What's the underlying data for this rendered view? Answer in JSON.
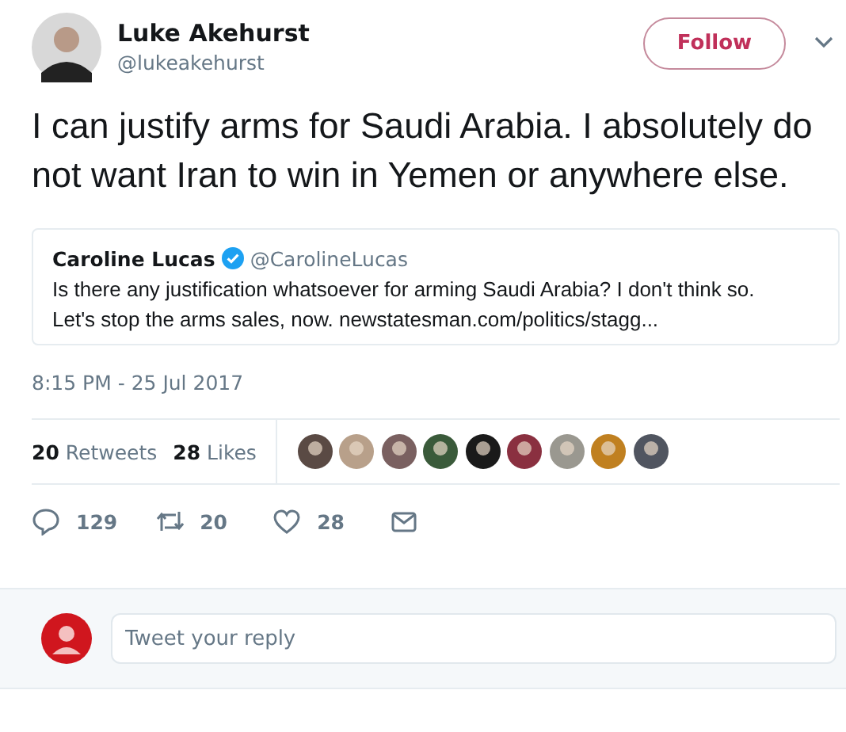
{
  "tweet": {
    "author": {
      "name": "Luke Akehurst",
      "handle": "@lukeakehurst"
    },
    "follow_button": "Follow",
    "text": "I can justify arms for Saudi Arabia. I absolutely do not want Iran to win in Yemen or anywhere else.",
    "quoted_tweet": {
      "name": "Caroline Lucas",
      "verified": true,
      "handle": "@CarolineLucas",
      "lines": [
        "Is there any justification whatsoever for arming Saudi Arabia? I don't think so.",
        "Let's stop the arms sales, now. newstatesman.com/politics/stagg..."
      ]
    },
    "timestamp": "8:15 PM - 25 Jul 2017",
    "stats": [
      {
        "count": "20",
        "label": "Retweets"
      },
      {
        "count": "28",
        "label": "Likes"
      }
    ],
    "likers": [
      {
        "color": "#5a4a44"
      },
      {
        "color": "#b8a08a"
      },
      {
        "color": "#7a6060"
      },
      {
        "color": "#3a5a3a"
      },
      {
        "color": "#1a1a1a"
      },
      {
        "color": "#8a3040"
      },
      {
        "color": "#9a9890"
      },
      {
        "color": "#c08020"
      },
      {
        "color": "#505560"
      }
    ],
    "actions": [
      {
        "kind": "reply",
        "count": "129"
      },
      {
        "kind": "retweet",
        "count": "20"
      },
      {
        "kind": "like",
        "count": "28"
      },
      {
        "kind": "message"
      }
    ]
  },
  "reply_box": {
    "placeholder": "Tweet your reply"
  }
}
